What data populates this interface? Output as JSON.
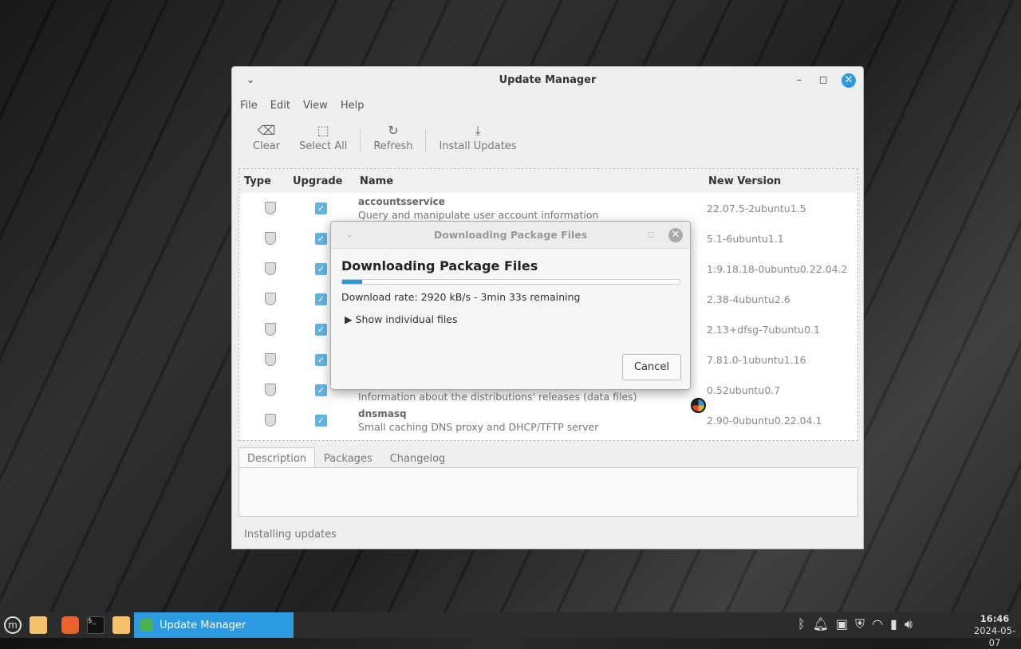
{
  "window": {
    "title": "Update Manager",
    "menu": [
      "File",
      "Edit",
      "View",
      "Help"
    ],
    "toolbar": {
      "clear": "Clear",
      "select_all": "Select All",
      "refresh": "Refresh",
      "install": "Install Updates"
    },
    "columns": {
      "type": "Type",
      "upgrade": "Upgrade",
      "name": "Name",
      "version": "New Version"
    },
    "rows": [
      {
        "name": "accountsservice",
        "desc": "Query and manipulate user account information",
        "version": "22.07.5-2ubuntu1.5"
      },
      {
        "name": "",
        "desc": "",
        "version": "5.1-6ubuntu1.1"
      },
      {
        "name": "",
        "desc": "",
        "version": "1:9.18.18-0ubuntu0.22.04.2"
      },
      {
        "name": "",
        "desc": "",
        "version": "2.38-4ubuntu2.6"
      },
      {
        "name": "",
        "desc": "",
        "version": "2.13+dfsg-7ubuntu0.1"
      },
      {
        "name": "",
        "desc": "",
        "version": "7.81.0-1ubuntu1.16"
      },
      {
        "name": "",
        "desc": "Information about the distributions' releases (data files)",
        "version": "0.52ubuntu0.7"
      },
      {
        "name": "dnsmasq",
        "desc": "Small caching DNS proxy and DHCP/TFTP server",
        "version": "2.90-0ubuntu0.22.04.1"
      }
    ],
    "tabs": [
      "Description",
      "Packages",
      "Changelog"
    ],
    "status": "Installing updates"
  },
  "dialog": {
    "title": "Downloading Package Files",
    "heading": "Downloading Package Files",
    "progress_percent": 6,
    "rate": "Download rate: 2920 kB/s - 3min 33s remaining",
    "expander": "Show individual files",
    "cancel": "Cancel"
  },
  "taskbar": {
    "active_task": "Update Manager",
    "time": "16:46",
    "date": "2024-05-07"
  },
  "colors": {
    "accent": "#2c9ae0"
  }
}
